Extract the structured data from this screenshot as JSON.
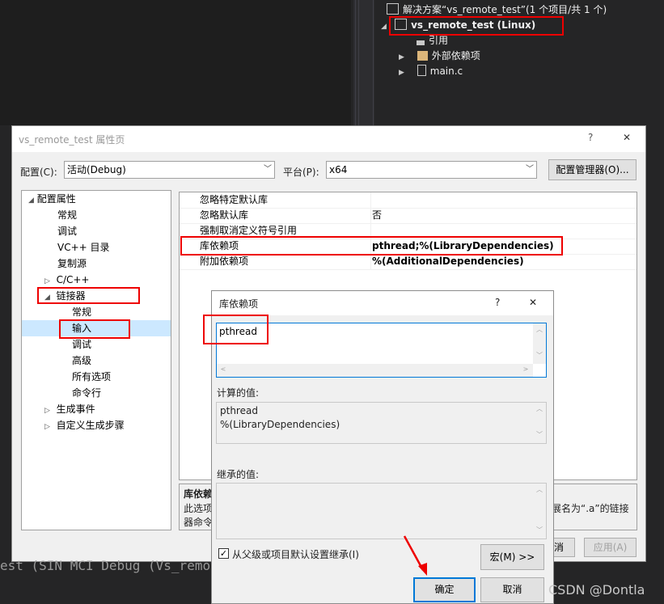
{
  "solution_explorer": {
    "solution_label": "解决方案“vs_remote_test”(1 个项目/共 1 个)",
    "project_label": "vs_remote_test (Linux)",
    "items": [
      "引用",
      "外部依赖项",
      "main.c"
    ]
  },
  "property_window": {
    "title": "vs_remote_test 属性页",
    "help": "?",
    "close": "✕",
    "config_label": "配置(C):",
    "config_value": "活动(Debug)",
    "platform_label": "平台(P):",
    "platform_value": "x64",
    "config_manager_button": "配置管理器(O)...",
    "tree": {
      "root": "配置属性",
      "items": [
        "常规",
        "调试",
        "VC++ 目录",
        "复制源",
        "C/C++",
        "链接器"
      ],
      "linker_children": [
        "常规",
        "输入",
        "调试",
        "高级",
        "所有选项",
        "命令行"
      ],
      "tail": [
        "生成事件",
        "自定义生成步骤"
      ]
    },
    "grid": [
      {
        "name": "忽略特定默认库",
        "value": ""
      },
      {
        "name": "忽略默认库",
        "value": "否"
      },
      {
        "name": "强制取消定义符号引用",
        "value": ""
      },
      {
        "name": "库依赖项",
        "value": "pthread;%(LibraryDependencies)"
      },
      {
        "name": "附加依赖项",
        "value": "%(AdditionalDependencies)"
      }
    ],
    "description": {
      "title": "库依赖",
      "line1": "此选项",
      "line2": "器命令",
      "right_text": "展名为“.a”的链接"
    },
    "partial_ok": "消",
    "apply_button": "应用(A)"
  },
  "dialog": {
    "title": "库依赖项",
    "help": "?",
    "close": "✕",
    "edit_value": "pthread",
    "computed_label": "计算的值:",
    "computed_lines": [
      "pthread",
      "%(LibraryDependencies)"
    ],
    "inherited_label": "继承的值:",
    "inherit_checkbox": "从父级或项目默认设置继承(I)",
    "macro_button": "宏(M) >>",
    "ok_button": "确定",
    "cancel_button": "取消"
  },
  "background_text": "est (SIN MCI Debug (Vs_remote",
  "watermark": "CSDN @Dontla",
  "colors": {
    "accent": "#0078d7",
    "highlight": "#e00000",
    "selection": "#cce8ff"
  }
}
